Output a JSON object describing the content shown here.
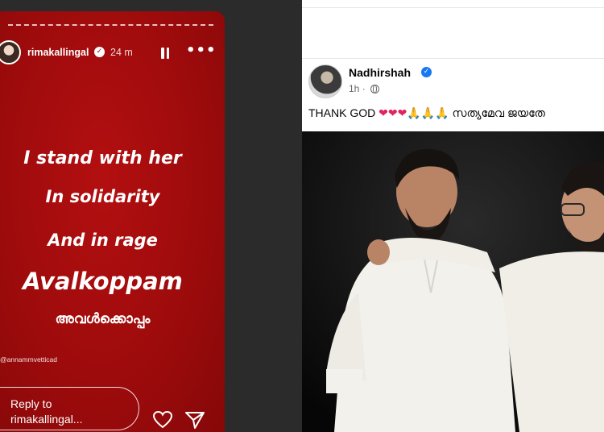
{
  "story": {
    "username": "rimakallingal",
    "time_ago": "24 m",
    "lines": [
      "I stand with her",
      "In solidarity",
      "And in rage",
      "Avalkoppam",
      "അവൾക്കൊപ്പം"
    ],
    "mention": "@annammvetticad",
    "reply_placeholder": "Reply to rimakallingal...",
    "colors": {
      "background": "#a50c0c"
    },
    "icons": [
      "verified-icon",
      "pause-icon",
      "more-icon",
      "heart-icon",
      "send-icon"
    ]
  },
  "facebook_post": {
    "author": "Nadhirshah",
    "time_ago": "1h",
    "separator": "·",
    "caption_text": "THANK GOD",
    "caption_emojis": "❤❤❤🙏🙏🙏",
    "caption_malayalam": "സത്യമേവ ജയതേ",
    "colors": {
      "verified": "#1877f2",
      "heart": "#e0245e",
      "hands": "#f4b400"
    },
    "icons": [
      "verified-icon",
      "globe-icon"
    ]
  }
}
